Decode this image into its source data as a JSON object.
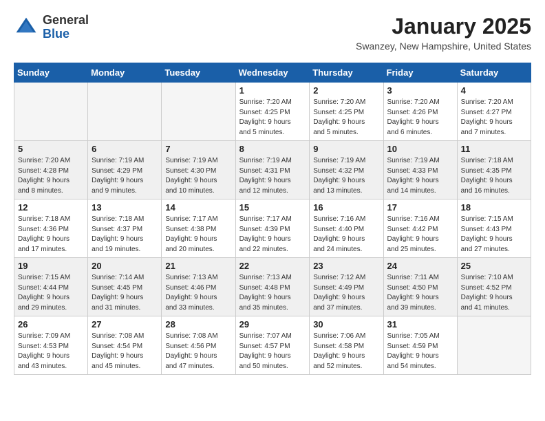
{
  "header": {
    "logo_line1": "General",
    "logo_line2": "Blue",
    "month": "January 2025",
    "location": "Swanzey, New Hampshire, United States"
  },
  "weekdays": [
    "Sunday",
    "Monday",
    "Tuesday",
    "Wednesday",
    "Thursday",
    "Friday",
    "Saturday"
  ],
  "weeks": [
    {
      "shaded": false,
      "days": [
        {
          "num": "",
          "empty": true
        },
        {
          "num": "",
          "empty": true
        },
        {
          "num": "",
          "empty": true
        },
        {
          "num": "1",
          "info": "Sunrise: 7:20 AM\nSunset: 4:25 PM\nDaylight: 9 hours\nand 5 minutes."
        },
        {
          "num": "2",
          "info": "Sunrise: 7:20 AM\nSunset: 4:25 PM\nDaylight: 9 hours\nand 5 minutes."
        },
        {
          "num": "3",
          "info": "Sunrise: 7:20 AM\nSunset: 4:26 PM\nDaylight: 9 hours\nand 6 minutes."
        },
        {
          "num": "4",
          "info": "Sunrise: 7:20 AM\nSunset: 4:27 PM\nDaylight: 9 hours\nand 7 minutes."
        }
      ]
    },
    {
      "shaded": true,
      "days": [
        {
          "num": "5",
          "info": "Sunrise: 7:20 AM\nSunset: 4:28 PM\nDaylight: 9 hours\nand 8 minutes."
        },
        {
          "num": "6",
          "info": "Sunrise: 7:19 AM\nSunset: 4:29 PM\nDaylight: 9 hours\nand 9 minutes."
        },
        {
          "num": "7",
          "info": "Sunrise: 7:19 AM\nSunset: 4:30 PM\nDaylight: 9 hours\nand 10 minutes."
        },
        {
          "num": "8",
          "info": "Sunrise: 7:19 AM\nSunset: 4:31 PM\nDaylight: 9 hours\nand 12 minutes."
        },
        {
          "num": "9",
          "info": "Sunrise: 7:19 AM\nSunset: 4:32 PM\nDaylight: 9 hours\nand 13 minutes."
        },
        {
          "num": "10",
          "info": "Sunrise: 7:19 AM\nSunset: 4:33 PM\nDaylight: 9 hours\nand 14 minutes."
        },
        {
          "num": "11",
          "info": "Sunrise: 7:18 AM\nSunset: 4:35 PM\nDaylight: 9 hours\nand 16 minutes."
        }
      ]
    },
    {
      "shaded": false,
      "days": [
        {
          "num": "12",
          "info": "Sunrise: 7:18 AM\nSunset: 4:36 PM\nDaylight: 9 hours\nand 17 minutes."
        },
        {
          "num": "13",
          "info": "Sunrise: 7:18 AM\nSunset: 4:37 PM\nDaylight: 9 hours\nand 19 minutes."
        },
        {
          "num": "14",
          "info": "Sunrise: 7:17 AM\nSunset: 4:38 PM\nDaylight: 9 hours\nand 20 minutes."
        },
        {
          "num": "15",
          "info": "Sunrise: 7:17 AM\nSunset: 4:39 PM\nDaylight: 9 hours\nand 22 minutes."
        },
        {
          "num": "16",
          "info": "Sunrise: 7:16 AM\nSunset: 4:40 PM\nDaylight: 9 hours\nand 24 minutes."
        },
        {
          "num": "17",
          "info": "Sunrise: 7:16 AM\nSunset: 4:42 PM\nDaylight: 9 hours\nand 25 minutes."
        },
        {
          "num": "18",
          "info": "Sunrise: 7:15 AM\nSunset: 4:43 PM\nDaylight: 9 hours\nand 27 minutes."
        }
      ]
    },
    {
      "shaded": true,
      "days": [
        {
          "num": "19",
          "info": "Sunrise: 7:15 AM\nSunset: 4:44 PM\nDaylight: 9 hours\nand 29 minutes."
        },
        {
          "num": "20",
          "info": "Sunrise: 7:14 AM\nSunset: 4:45 PM\nDaylight: 9 hours\nand 31 minutes."
        },
        {
          "num": "21",
          "info": "Sunrise: 7:13 AM\nSunset: 4:46 PM\nDaylight: 9 hours\nand 33 minutes."
        },
        {
          "num": "22",
          "info": "Sunrise: 7:13 AM\nSunset: 4:48 PM\nDaylight: 9 hours\nand 35 minutes."
        },
        {
          "num": "23",
          "info": "Sunrise: 7:12 AM\nSunset: 4:49 PM\nDaylight: 9 hours\nand 37 minutes."
        },
        {
          "num": "24",
          "info": "Sunrise: 7:11 AM\nSunset: 4:50 PM\nDaylight: 9 hours\nand 39 minutes."
        },
        {
          "num": "25",
          "info": "Sunrise: 7:10 AM\nSunset: 4:52 PM\nDaylight: 9 hours\nand 41 minutes."
        }
      ]
    },
    {
      "shaded": false,
      "days": [
        {
          "num": "26",
          "info": "Sunrise: 7:09 AM\nSunset: 4:53 PM\nDaylight: 9 hours\nand 43 minutes."
        },
        {
          "num": "27",
          "info": "Sunrise: 7:08 AM\nSunset: 4:54 PM\nDaylight: 9 hours\nand 45 minutes."
        },
        {
          "num": "28",
          "info": "Sunrise: 7:08 AM\nSunset: 4:56 PM\nDaylight: 9 hours\nand 47 minutes."
        },
        {
          "num": "29",
          "info": "Sunrise: 7:07 AM\nSunset: 4:57 PM\nDaylight: 9 hours\nand 50 minutes."
        },
        {
          "num": "30",
          "info": "Sunrise: 7:06 AM\nSunset: 4:58 PM\nDaylight: 9 hours\nand 52 minutes."
        },
        {
          "num": "31",
          "info": "Sunrise: 7:05 AM\nSunset: 4:59 PM\nDaylight: 9 hours\nand 54 minutes."
        },
        {
          "num": "",
          "empty": true
        }
      ]
    }
  ]
}
